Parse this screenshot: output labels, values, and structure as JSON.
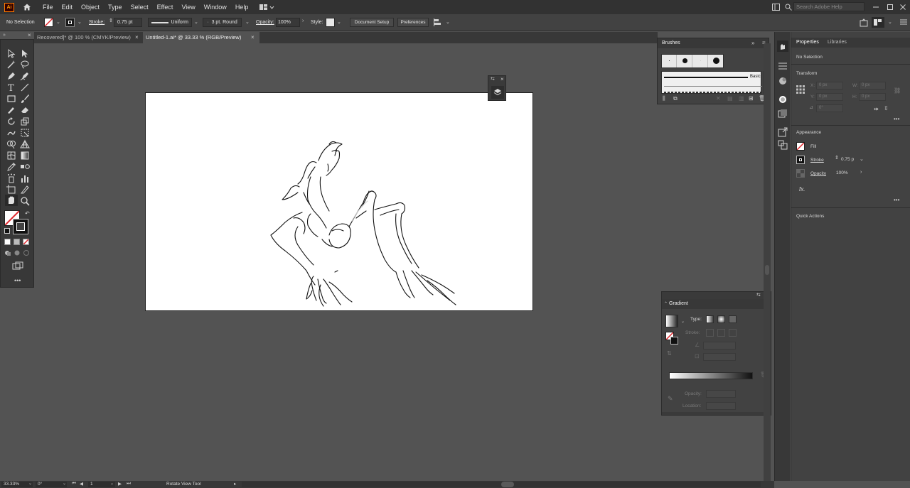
{
  "app": {
    "logo": "Ai"
  },
  "menu": [
    "File",
    "Edit",
    "Object",
    "Type",
    "Select",
    "Effect",
    "View",
    "Window",
    "Help"
  ],
  "search": {
    "placeholder": "Search Adobe Help"
  },
  "control_bar": {
    "selection": "No Selection",
    "stroke_label": "Stroke:",
    "stroke_value": "0.75 pt",
    "profile": "Uniform",
    "brush": "3 pt. Round",
    "opacity_label": "Opacity:",
    "opacity_value": "100%",
    "style_label": "Style:",
    "document_setup": "Document Setup",
    "preferences": "Preferences"
  },
  "tabs": [
    {
      "label": "Recovered]* @ 100 % (CMYK/Preview)",
      "active": false
    },
    {
      "label": "Untitled-1.ai* @ 33.33 % (RGB/Preview)",
      "active": true
    }
  ],
  "brushes_panel": {
    "title": "Brushes",
    "basic_label": "Basic"
  },
  "gradient_panel": {
    "title": "Gradient",
    "type_label": "Type:",
    "stroke_label": "Stroke:",
    "opacity_label": "Opacity:",
    "location_label": "Location:"
  },
  "properties": {
    "tabs": [
      "Properties",
      "Libraries"
    ],
    "selection": "No Selection",
    "transform_title": "Transform",
    "x_label": "X:",
    "y_label": "Y:",
    "w_label": "W:",
    "h_label": "H:",
    "appearance_title": "Appearance",
    "fill_label": "Fill",
    "stroke_label": "Stroke",
    "stroke_value": "0.75 p",
    "opacity_label": "Opacity",
    "opacity_value": "100%",
    "fx_label": "fx.",
    "quick_actions_title": "Quick Actions"
  },
  "status_bar": {
    "zoom": "33.33%",
    "rotation": "0°",
    "artboard": "1",
    "tool": "Rotate View Tool"
  },
  "colors": {
    "menu_bg": "#323232",
    "panel_bg": "#424242",
    "canvas_bg": "#535353",
    "accent_logo": "#ff9a00"
  }
}
